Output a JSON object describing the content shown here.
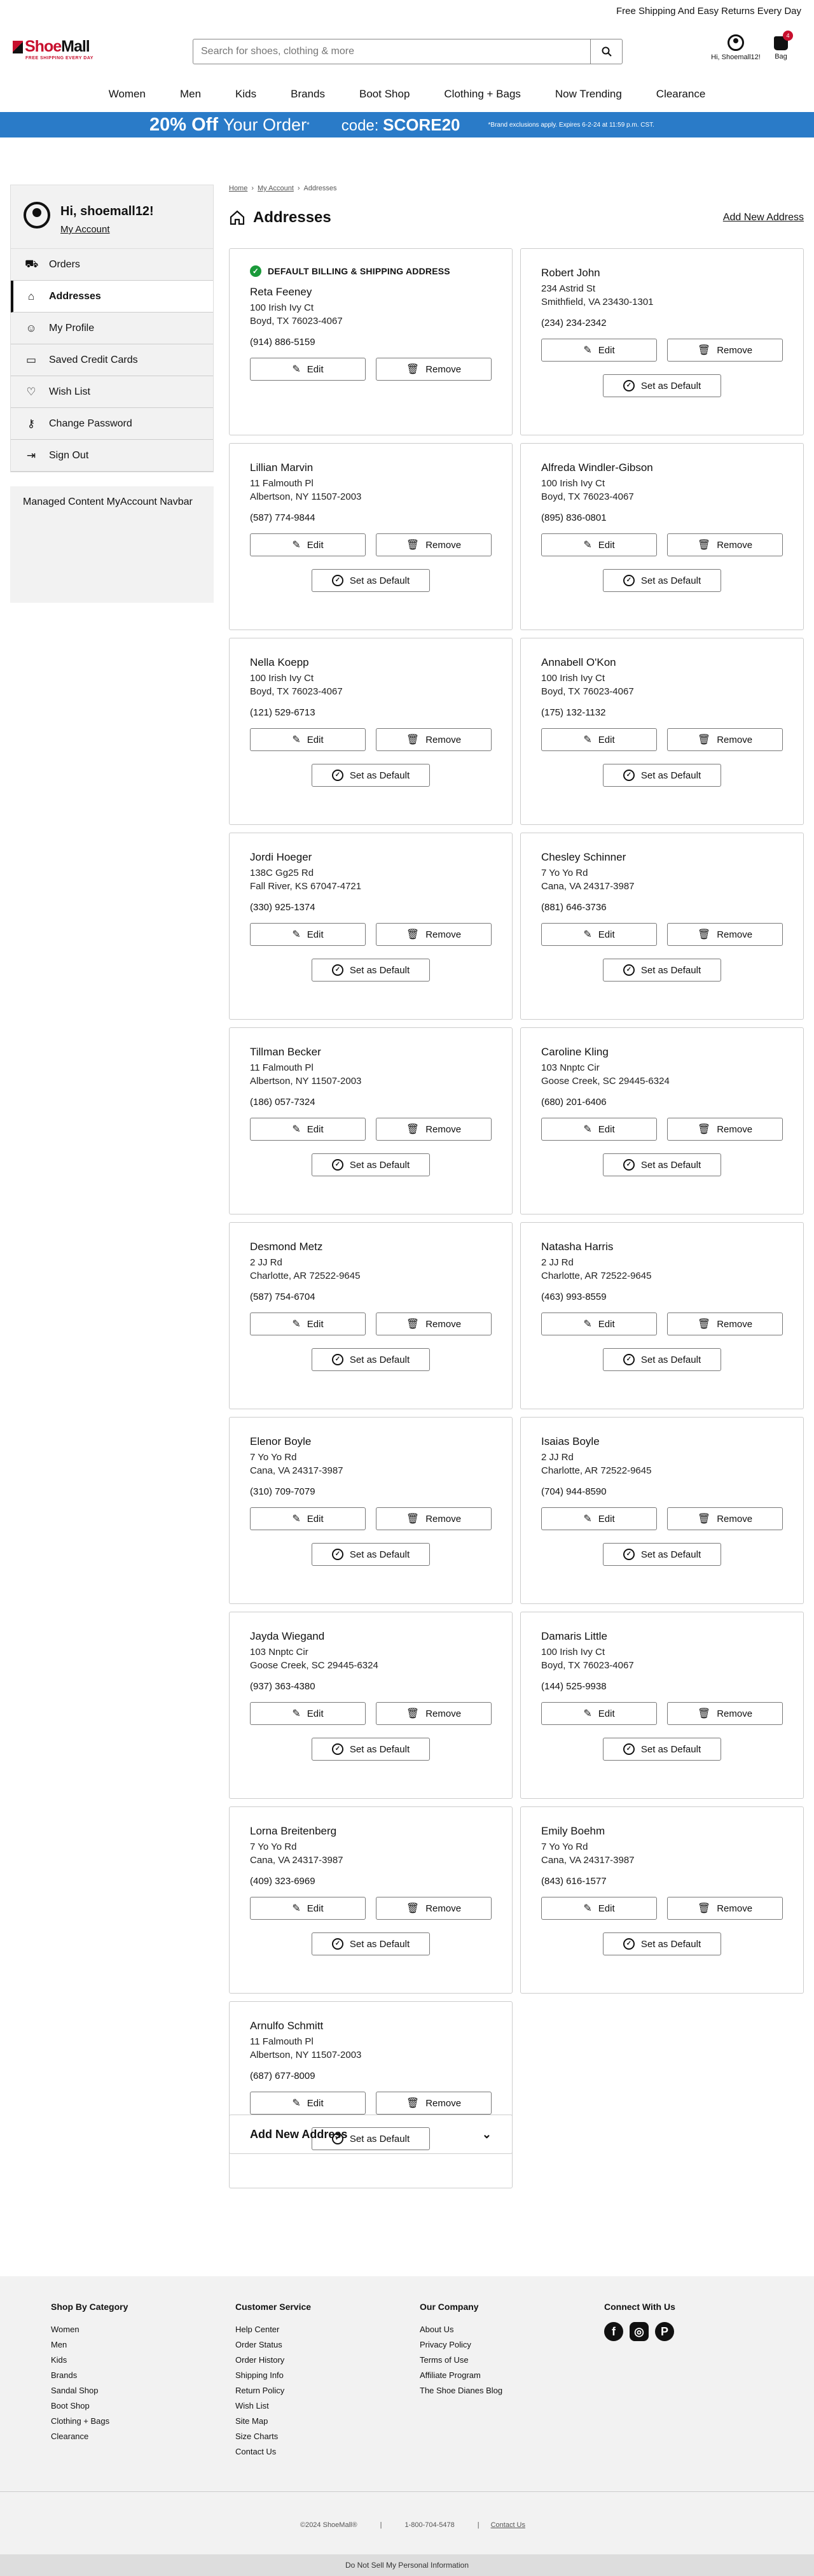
{
  "topbar": {
    "text": "Free Shipping And Easy Returns Every Day"
  },
  "logo": {
    "shoe": "Shoe",
    "mall": "Mall",
    "sub": "FREE SHIPPING EVERY DAY"
  },
  "search": {
    "placeholder": "Search for shoes, clothing & more"
  },
  "account": {
    "greeting": "Hi, Shoemall12!"
  },
  "bag": {
    "label": "Bag",
    "count": "4"
  },
  "nav": [
    "Women",
    "Men",
    "Kids",
    "Brands",
    "Boot Shop",
    "Clothing + Bags",
    "Now Trending",
    "Clearance"
  ],
  "promo": {
    "percent": "20% Off",
    "your_order": "Your Order",
    "asterisk": "*",
    "code_label": "code:",
    "code": "SCORE20",
    "fine": "*Brand exclusions apply. Expires 6-2-24 at 11:59 p.m. CST."
  },
  "sidebar": {
    "greeting": "Hi, shoemall12!",
    "my_account": "My Account",
    "items": [
      {
        "label": "Orders",
        "icon": "truck-icon"
      },
      {
        "label": "Addresses",
        "icon": "home-icon"
      },
      {
        "label": "My Profile",
        "icon": "profile-icon"
      },
      {
        "label": "Saved Credit Cards",
        "icon": "credit-card-icon"
      },
      {
        "label": "Wish List",
        "icon": "heart-icon"
      },
      {
        "label": "Change Password",
        "icon": "key-icon"
      },
      {
        "label": "Sign Out",
        "icon": "sign-out-icon"
      }
    ],
    "managed": "Managed Content MyAccount Navbar"
  },
  "breadcrumb": [
    "Home",
    "My Account",
    "Addresses"
  ],
  "page": {
    "title": "Addresses",
    "add_link": "Add New Address"
  },
  "labels": {
    "default": "DEFAULT BILLING & SHIPPING ADDRESS",
    "edit": "Edit",
    "remove": "Remove",
    "set_default": "Set as Default"
  },
  "addresses": [
    {
      "name": "Reta Feeney",
      "line1": "100 Irish Ivy Ct",
      "line2": "Boyd, TX 76023-4067",
      "phone": "(914) 886-5159"
    },
    {
      "name": "Robert John",
      "line1": "234 Astrid St",
      "line2": "Smithfield, VA 23430-1301",
      "phone": "(234) 234-2342"
    },
    {
      "name": "Lillian Marvin",
      "line1": "11 Falmouth Pl",
      "line2": "Albertson, NY 11507-2003",
      "phone": "(587) 774-9844"
    },
    {
      "name": "Alfreda Windler-Gibson",
      "line1": "100 Irish Ivy Ct",
      "line2": "Boyd, TX 76023-4067",
      "phone": "(895) 836-0801"
    },
    {
      "name": "Nella Koepp",
      "line1": "100 Irish Ivy Ct",
      "line2": "Boyd, TX 76023-4067",
      "phone": "(121) 529-6713"
    },
    {
      "name": "Annabell O'Kon",
      "line1": "100 Irish Ivy Ct",
      "line2": "Boyd, TX 76023-4067",
      "phone": "(175) 132-1132"
    },
    {
      "name": "Jordi Hoeger",
      "line1": "138C Gg25 Rd",
      "line2": "Fall River, KS 67047-4721",
      "phone": "(330) 925-1374"
    },
    {
      "name": "Chesley Schinner",
      "line1": "7 Yo Yo Rd",
      "line2": "Cana, VA 24317-3987",
      "phone": "(881) 646-3736"
    },
    {
      "name": "Tillman Becker",
      "line1": "11 Falmouth Pl",
      "line2": "Albertson, NY 11507-2003",
      "phone": "(186) 057-7324"
    },
    {
      "name": "Caroline Kling",
      "line1": "103 Nnptc Cir",
      "line2": "Goose Creek, SC 29445-6324",
      "phone": "(680) 201-6406"
    },
    {
      "name": "Desmond Metz",
      "line1": "2 JJ Rd",
      "line2": "Charlotte, AR 72522-9645",
      "phone": "(587) 754-6704"
    },
    {
      "name": "Natasha Harris",
      "line1": "2 JJ Rd",
      "line2": "Charlotte, AR 72522-9645",
      "phone": "(463) 993-8559"
    },
    {
      "name": "Elenor Boyle",
      "line1": "7 Yo Yo Rd",
      "line2": "Cana, VA 24317-3987",
      "phone": "(310) 709-7079"
    },
    {
      "name": "Isaias Boyle",
      "line1": "2 JJ Rd",
      "line2": "Charlotte, AR 72522-9645",
      "phone": "(704) 944-8590"
    },
    {
      "name": "Jayda Wiegand",
      "line1": "103 Nnptc Cir",
      "line2": "Goose Creek, SC 29445-6324",
      "phone": "(937) 363-4380"
    },
    {
      "name": "Damaris Little",
      "line1": "100 Irish Ivy Ct",
      "line2": "Boyd, TX 76023-4067",
      "phone": "(144) 525-9938"
    },
    {
      "name": "Lorna Breitenberg",
      "line1": "7 Yo Yo Rd",
      "line2": "Cana, VA 24317-3987",
      "phone": "(409) 323-6969"
    },
    {
      "name": "Emily Boehm",
      "line1": "7 Yo Yo Rd",
      "line2": "Cana, VA 24317-3987",
      "phone": "(843) 616-1577"
    },
    {
      "name": "Arnulfo Schmitt",
      "line1": "11 Falmouth Pl",
      "line2": "Albertson, NY 11507-2003",
      "phone": "(687) 677-8009"
    }
  ],
  "add_new_section": "Add New Address",
  "footer": {
    "cols": [
      {
        "title": "Shop By Category",
        "links": [
          "Women",
          "Men",
          "Kids",
          "Brands",
          "Sandal Shop",
          "Boot Shop",
          "Clothing + Bags",
          "Clearance"
        ]
      },
      {
        "title": "Customer Service",
        "links": [
          "Help Center",
          "Order Status",
          "Order History",
          "Shipping Info",
          "Return Policy",
          "Wish List",
          "Site Map",
          "Size Charts",
          "Contact Us"
        ]
      },
      {
        "title": "Our Company",
        "links": [
          "About Us",
          "Privacy Policy",
          "Terms of Use",
          "Affiliate Program",
          "The Shoe Dianes Blog"
        ]
      }
    ],
    "connect": "Connect With Us",
    "social_icons": [
      "facebook-icon",
      "instagram-icon",
      "pinterest-icon"
    ],
    "copyright": "©2024 ShoeMall®",
    "phone": "1-800-704-5478",
    "contact": "Contact Us",
    "dnsmpi": "Do Not Sell My Personal Information"
  },
  "colors": {
    "brand_red": "#c8102e",
    "promo_blue": "#2a7bc8",
    "default_green": "#1a9a3a"
  }
}
